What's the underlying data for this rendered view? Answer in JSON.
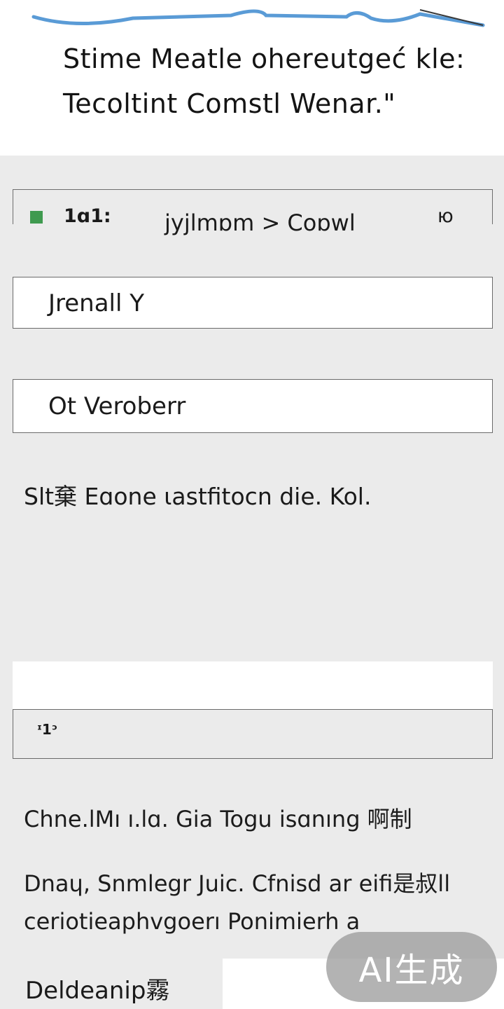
{
  "header": {
    "line1": "Stime Meatle oherеutgeć kle:",
    "line2": "Tecoltint Comstl Wenar.\""
  },
  "status_bar": {
    "time": "1ɑ1:",
    "breadcrumb": "jyjlmɒm > Coɒwl",
    "right_text": "ю"
  },
  "fields": [
    {
      "value": "Jrenall Y"
    },
    {
      "value": "Ot Veroberr"
    }
  ],
  "notice": "Slt棄 Eɑone ɩastfitocn die. Kol.",
  "code_field": {
    "value": "ᶦ1ᵓ"
  },
  "paragraphs": [
    "Chne.lMı ı.lɑ. Gia Togu isɑnıng 啊制",
    "Dnaɥ, Snmlegr Juic. Cfnisd ar eifi是叔ll",
    "ceriotieaphvgoerı Ponimierh a"
  ],
  "bottom_label": "Deldeanip霧",
  "watermark": "AI生成",
  "colors": {
    "status_indicator": "#3f9a4f",
    "deco_stroke": "#5a9bd6",
    "background": "#ebebeb"
  }
}
